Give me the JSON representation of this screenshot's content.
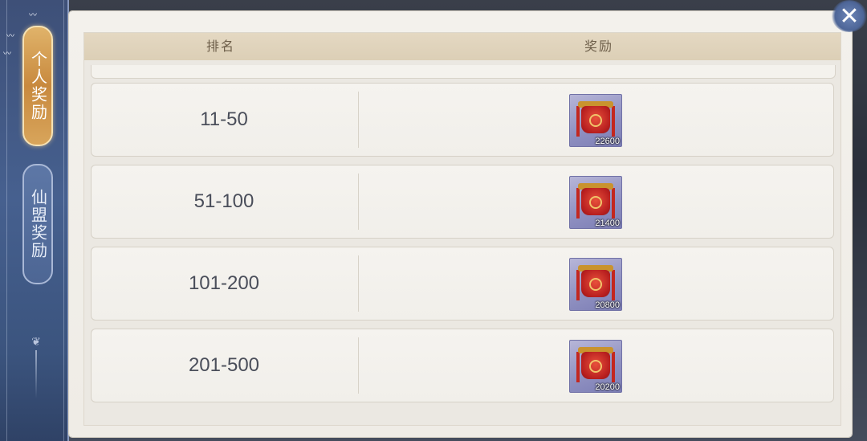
{
  "sidebar": {
    "tabs": [
      {
        "label": "个人奖励",
        "active": true
      },
      {
        "label": "仙盟奖励",
        "active": false
      }
    ]
  },
  "table": {
    "headers": {
      "rank": "排名",
      "reward": "奖励"
    },
    "rows": [
      {
        "rank": "11-50",
        "reward_count": "22600",
        "reward_icon": "lantern-item-icon"
      },
      {
        "rank": "51-100",
        "reward_count": "21400",
        "reward_icon": "lantern-item-icon"
      },
      {
        "rank": "101-200",
        "reward_count": "20800",
        "reward_icon": "lantern-item-icon"
      },
      {
        "rank": "201-500",
        "reward_count": "20200",
        "reward_icon": "lantern-item-icon"
      }
    ]
  },
  "close_icon": "close-icon",
  "colors": {
    "panel_bg": "#f3f1ec",
    "header_bg": "#e4d8c2",
    "active_tab": "#d8a55b",
    "sidebar": "#46608f"
  }
}
